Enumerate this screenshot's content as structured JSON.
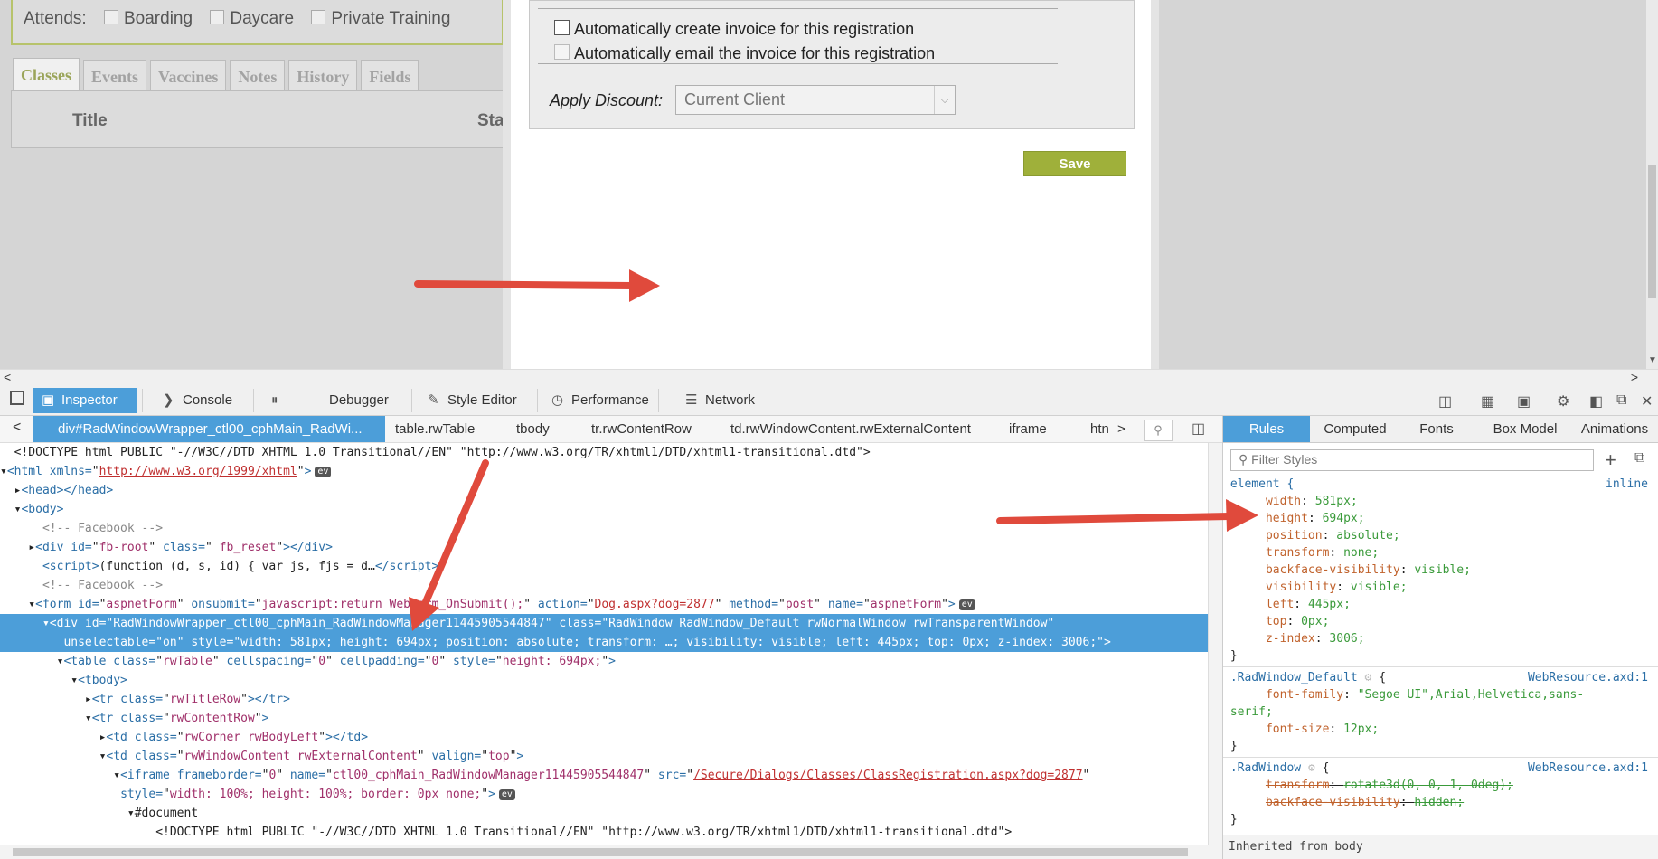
{
  "page": {
    "attends_label": "Attends:",
    "attends_options": [
      "Boarding",
      "Daycare",
      "Private Training"
    ],
    "tabs": [
      "Classes",
      "Events",
      "Vaccines",
      "Notes",
      "History",
      "Fields"
    ],
    "table_headers": [
      "Title",
      "Sta"
    ]
  },
  "dialog": {
    "option_invoice": "Automatically create invoice for this registration",
    "option_email": "Automatically email the invoice for this registration",
    "discount_label": "Apply Discount:",
    "discount_value": "Current Client",
    "save_label": "Save"
  },
  "devtools": {
    "tabs": [
      "Inspector",
      "Console",
      "Debugger",
      "Style Editor",
      "Performance",
      "Network"
    ],
    "breadcrumbs": [
      "div#RadWindowWrapper_ctl00_cphMain_RadWi...",
      "table.rwTable",
      "tbody",
      "tr.rwContentRow",
      "td.rwWindowContent.rwExternalContent",
      "iframe",
      "htn"
    ],
    "markup": {
      "doctype": "<!DOCTYPE html PUBLIC \"-//W3C//DTD XHTML 1.0 Transitional//EN\" \"http://www.w3.org/TR/xhtml1/DTD/xhtml1-transitional.dtd\">",
      "html_ns": "http://www.w3.org/1999/xhtml",
      "comment_fb": "<!-- Facebook -->",
      "script_text": "(function (d, s, id) { var js, fjs = d…",
      "form_onsubmit": "javascript:return WebForm_OnSubmit();",
      "form_action": "Dog.aspx?dog=2877",
      "div_id": "RadWindowWrapper_ctl00_cphMain_RadWindowManager11445905544847",
      "div_class": "RadWindow RadWindow_Default rwNormalWindow rwTransparentWindow",
      "div_style": "width: 581px; height: 694px; position: absolute; transform: …; visibility: visible; left: 445px; top: 0px; z-index: 3006;",
      "table_style": "height: 694px;",
      "iframe_name": "ctl00_cphMain_RadWindowManager11445905544847",
      "iframe_src": "/Secure/Dialogs/Classes/ClassRegistration.aspx?dog=2877",
      "iframe_style": "width: 100%; height: 100%; border: 0px none;",
      "document_label": "#document"
    },
    "side_tabs": [
      "Rules",
      "Computed",
      "Fonts",
      "Box Model",
      "Animations"
    ],
    "filter_placeholder": "Filter Styles",
    "rules": {
      "element_selector": "element {",
      "element_source": "inline",
      "element_props": [
        [
          "width",
          "581px;"
        ],
        [
          "height",
          "694px;"
        ],
        [
          "position",
          "absolute;"
        ],
        [
          "transform",
          "none;"
        ],
        [
          "backface-visibility",
          "visible;"
        ],
        [
          "visibility",
          "visible;"
        ],
        [
          "left",
          "445px;"
        ],
        [
          "top",
          "0px;"
        ],
        [
          "z-index",
          "3006;"
        ]
      ],
      "default_selector": ".RadWindow_Default",
      "default_source": "WebResource.axd:1",
      "default_font_family": "\"Segoe UI\",Arial,Helvetica,sans-",
      "default_font_family_cont": "serif;",
      "default_font_size": "12px;",
      "radwindow_selector": ".RadWindow",
      "radwindow_source": "WebResource.axd:1",
      "radwindow_transform": "rotate3d(0, 0, 1, 0deg);",
      "radwindow_backface": "hidden;",
      "inherited": "Inherited from body"
    }
  }
}
